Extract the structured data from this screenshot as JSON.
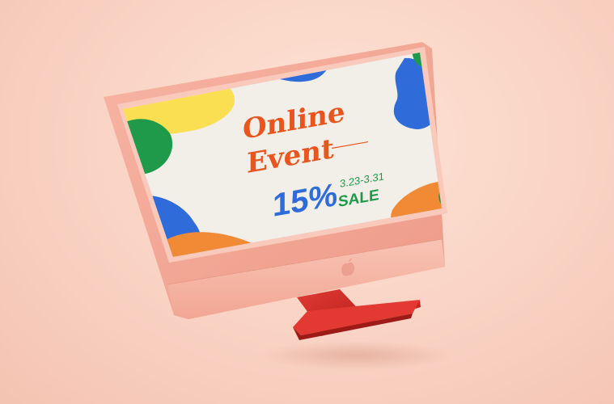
{
  "promo": {
    "title_line1": "Online",
    "title_line2": "Event",
    "discount": "15%",
    "dates": "3.23-3.31",
    "sale_label": "SALE"
  },
  "colors": {
    "background": "#f9d2c3",
    "monitor_body": "#f3a998",
    "monitor_chin": "#f6b7a6",
    "stand": "#d92e2a",
    "screen_bg": "#f2efe8",
    "headline": "#e8551f",
    "blue": "#2f6bd9",
    "green": "#1f9a4a",
    "yellow": "#fbdf52",
    "orange": "#f08a35"
  },
  "icons": {
    "logo": "apple-logo-icon"
  }
}
